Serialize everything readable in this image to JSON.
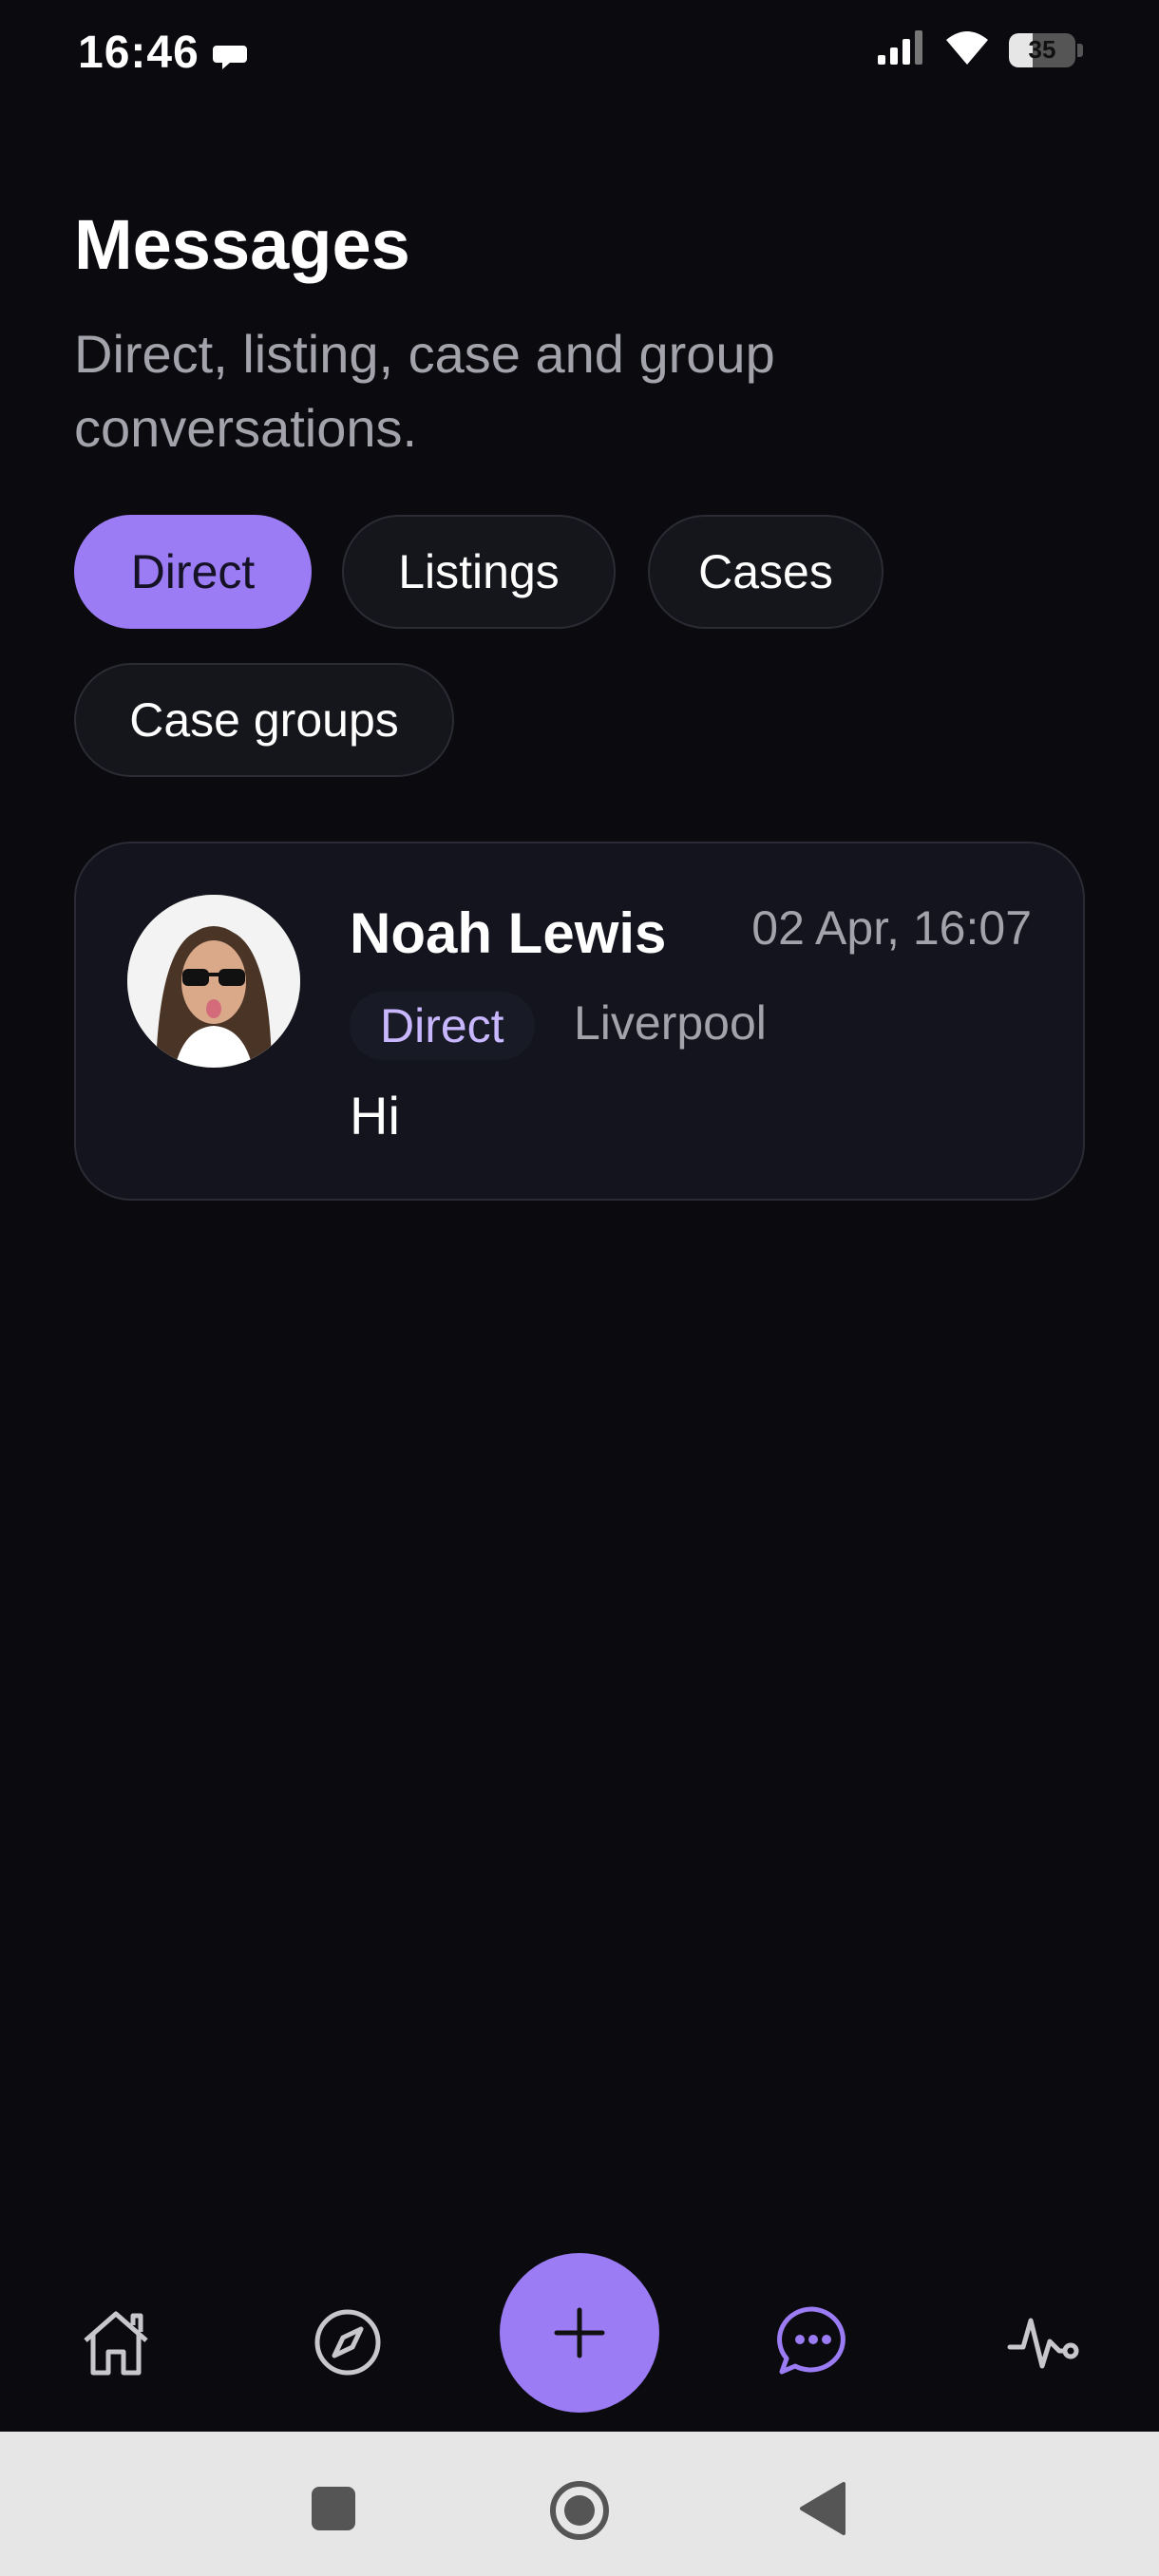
{
  "status_bar": {
    "time": "16:46",
    "battery_percent": "35",
    "battery_level": 0.35
  },
  "header": {
    "title": "Messages",
    "subtitle": "Direct, listing, case and group conversations."
  },
  "filters": [
    {
      "label": "Direct",
      "active": true
    },
    {
      "label": "Listings",
      "active": false
    },
    {
      "label": "Cases",
      "active": false
    },
    {
      "label": "Case groups",
      "active": false
    }
  ],
  "conversations": [
    {
      "name": "Noah Lewis",
      "timestamp": "02 Apr, 16:07",
      "type_badge": "Direct",
      "location": "Liverpool",
      "last_message": "Hi",
      "avatar": "user-photo"
    }
  ],
  "bottom_nav": {
    "items": [
      {
        "icon": "home-icon",
        "active": false
      },
      {
        "icon": "compass-icon",
        "active": false
      },
      {
        "icon": "plus-icon",
        "active": false,
        "fab": true
      },
      {
        "icon": "chat-bubble-icon",
        "active": true
      },
      {
        "icon": "activity-pulse-icon",
        "active": false
      }
    ]
  },
  "system_nav": [
    "recents-square-icon",
    "home-circle-icon",
    "back-triangle-icon"
  ],
  "colors": {
    "background": "#0b0b0f",
    "accent": "#9b7cf4",
    "card": "#13141d",
    "muted_text": "#a3a3ab"
  }
}
